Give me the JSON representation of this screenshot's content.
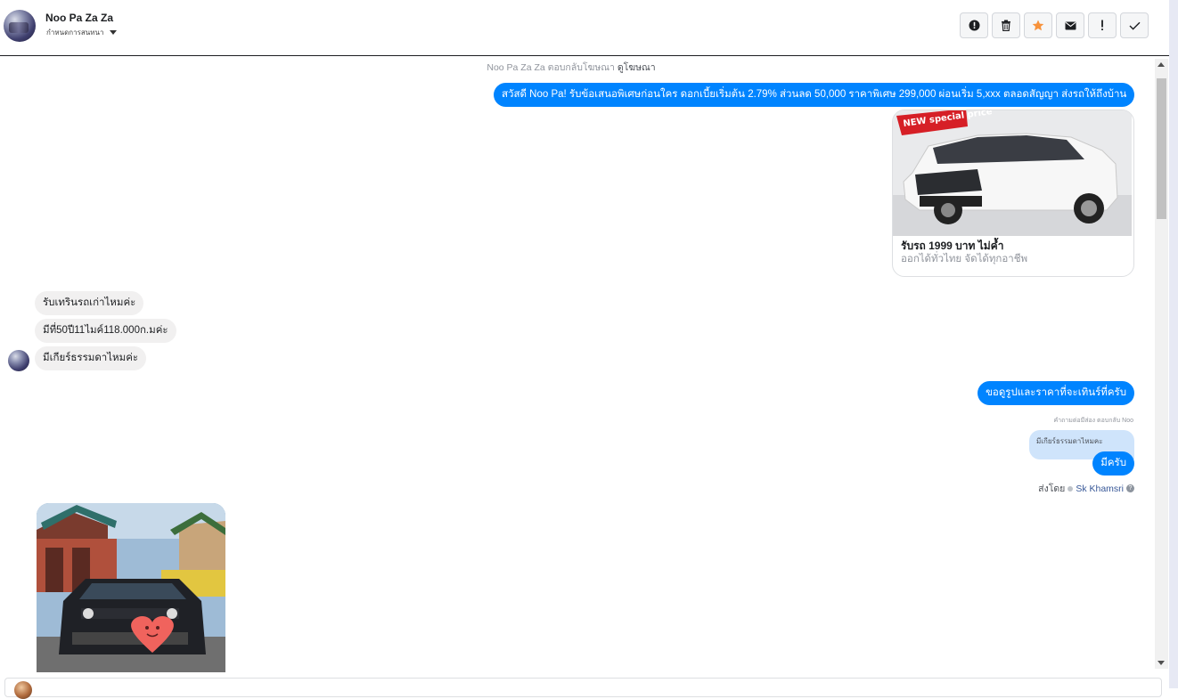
{
  "header": {
    "contact_name": "Noo Pa Za Za",
    "conversation_settings": "กำหนดการสนทนา",
    "actions": [
      {
        "name": "mark-spam",
        "icon": "alert-circle-icon"
      },
      {
        "name": "delete",
        "icon": "trash-icon"
      },
      {
        "name": "star",
        "icon": "star-icon"
      },
      {
        "name": "mark-unread",
        "icon": "mail-icon"
      },
      {
        "name": "important",
        "icon": "exclamation-icon"
      },
      {
        "name": "mark-done",
        "icon": "check-icon"
      }
    ]
  },
  "thread": {
    "ad_reply_prefix": "Noo Pa Za Za ตอบกลับโฆษณา",
    "ad_reply_link": "ดูโฆษณา",
    "ad_message": "สวัสดี Noo Pa! รับข้อเสนอพิเศษก่อนใคร ดอกเบี้ยเริ่มต้น 2.79%  ส่วนลด 50,000 ราคาพิเศษ 299,000 ผ่อนเริ่ม 5,xxx ตลอดสัญญา ส่งรถให้ถึงบ้าน",
    "ad_card": {
      "badge": "NEW special price",
      "title": "รับรถ 1999 บาท ไม่ค้ำ",
      "subtitle": "ออกได้ทั่วไทย จัดได้ทุกอาชีพ"
    },
    "incoming": [
      "รับเทรินรถเก่าไหมค่ะ",
      "มีที่50ปี11ไมค์118.000ก.มค่ะ",
      "มีเกียร์ธรรมดาไหมค่ะ"
    ],
    "outgoing_reply_1": "ขอดูรูปและราคาที่จะเทินร์ที่ครับ",
    "reply_note": "คำถามต่อมีส่อง ตอบกลับ Noo",
    "quoted_text": "มีเกียร์ธรรมดาไหมคะ",
    "outgoing_reply_2": "มีครับ",
    "sent_by_label": "ส่งโดย",
    "sent_by_agent": "Sk Khamsri",
    "help_glyph": "?"
  },
  "colors": {
    "bubble_out": "#0084ff",
    "bubble_in": "#f1f0f0",
    "star_active": "#f7923b"
  }
}
